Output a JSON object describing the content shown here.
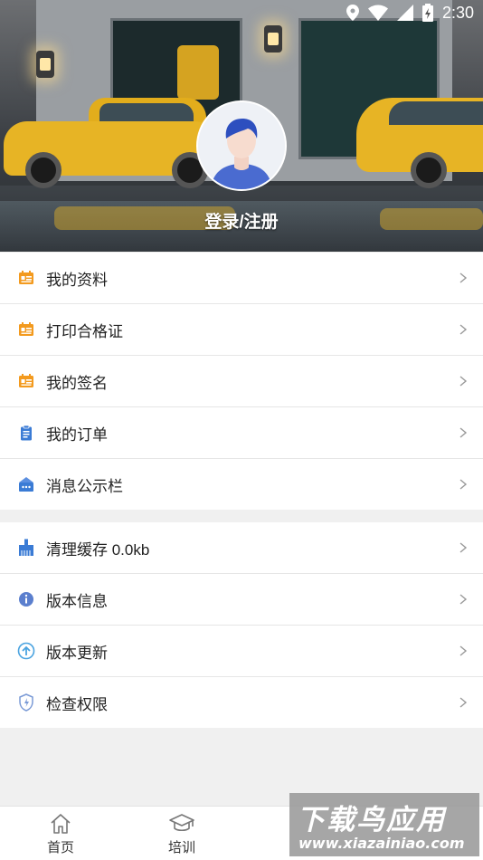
{
  "status_bar": {
    "time": "2:30",
    "icons": [
      "location-icon",
      "wifi-icon",
      "signal-icon",
      "battery-icon"
    ]
  },
  "profile": {
    "login_register": "登录/注册"
  },
  "menu_group_1": [
    {
      "label": "我的资料",
      "icon": "profile-card-icon"
    },
    {
      "label": "打印合格证",
      "icon": "certificate-icon"
    },
    {
      "label": "我的签名",
      "icon": "signature-icon"
    },
    {
      "label": "我的订单",
      "icon": "clipboard-icon"
    },
    {
      "label": "消息公示栏",
      "icon": "notice-board-icon"
    }
  ],
  "menu_group_2": [
    {
      "label": "清理缓存 0.0kb",
      "icon": "broom-icon"
    },
    {
      "label": "版本信息",
      "icon": "info-icon"
    },
    {
      "label": "版本更新",
      "icon": "upload-arrow-icon"
    },
    {
      "label": "检查权限",
      "icon": "shield-icon"
    }
  ],
  "bottom_nav": [
    {
      "label": "首页",
      "icon": "home-icon"
    },
    {
      "label": "培训",
      "icon": "graduation-cap-icon"
    }
  ],
  "watermark": {
    "title": "下载鸟应用",
    "url": "www.xiazainiao.com"
  },
  "colors": {
    "accent_orange": "#f39a1e",
    "accent_blue": "#3a7bd5",
    "text": "#222222",
    "divider": "#e6e6e6"
  }
}
